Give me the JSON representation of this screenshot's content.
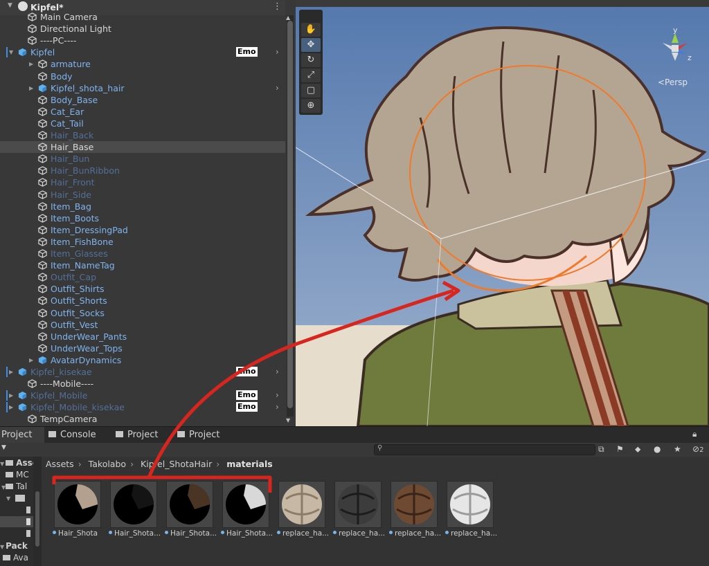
{
  "hierarchy": {
    "root": "Kipfel*",
    "emo_badge": "Emo",
    "items": [
      {
        "label": "Main Camera"
      },
      {
        "label": "Directional Light"
      },
      {
        "label": "----PC----"
      },
      {
        "label": "Kipfel"
      },
      {
        "label": "armature"
      },
      {
        "label": "Body"
      },
      {
        "label": "Kipfel_shota_hair"
      },
      {
        "label": "Body_Base"
      },
      {
        "label": "Cat_Ear"
      },
      {
        "label": "Cat_Tail"
      },
      {
        "label": "Hair_Back"
      },
      {
        "label": "Hair_Base"
      },
      {
        "label": "Hair_Bun"
      },
      {
        "label": "Hair_BunRibbon"
      },
      {
        "label": "Hair_Front"
      },
      {
        "label": "Hair_Side"
      },
      {
        "label": "Item_Bag"
      },
      {
        "label": "Item_Boots"
      },
      {
        "label": "Item_DressingPad"
      },
      {
        "label": "Item_FishBone"
      },
      {
        "label": "Item_Glasses"
      },
      {
        "label": "Item_NameTag"
      },
      {
        "label": "Outfit_Cap"
      },
      {
        "label": "Outfit_Shirts"
      },
      {
        "label": "Outfit_Shorts"
      },
      {
        "label": "Outfit_Socks"
      },
      {
        "label": "Outfit_Vest"
      },
      {
        "label": "UnderWear_Pants"
      },
      {
        "label": "UnderWear_Tops"
      },
      {
        "label": "AvatarDynamics"
      },
      {
        "label": "Kipfel_kisekae"
      },
      {
        "label": "----Mobile----"
      },
      {
        "label": "Kipfel_Mobile"
      },
      {
        "label": "Kipfel_Mobile_kisekae"
      },
      {
        "label": "TempCamera"
      }
    ]
  },
  "scene": {
    "persp_label": "<Persp",
    "axis_y": "y",
    "axis_z": "z"
  },
  "tabs": {
    "project_left": "Project",
    "console": "Console",
    "project_1": "Project",
    "project_2": "Project"
  },
  "project": {
    "tree": [
      {
        "label": "Asse"
      },
      {
        "label": "MC"
      },
      {
        "label": "Tal"
      },
      {
        "label": "Pack"
      },
      {
        "label": "Ava"
      }
    ],
    "breadcrumb": [
      "Assets",
      "Takolabo",
      "Kipfel_ShotaHair",
      "materials"
    ],
    "materials": [
      {
        "label": "Hair_Shota"
      },
      {
        "label": "Hair_Shota..."
      },
      {
        "label": "Hair_Shota..."
      },
      {
        "label": "Hair_Shota..."
      },
      {
        "label": "replace_ha..."
      },
      {
        "label": "replace_ha..."
      },
      {
        "label": "replace_ha..."
      },
      {
        "label": "replace_ha..."
      }
    ],
    "hidden_count": "2"
  },
  "colors": {
    "accent_blue": "#3d8ee8",
    "annotation_red": "#d8261e",
    "selection_orange": "#f07a2a"
  }
}
